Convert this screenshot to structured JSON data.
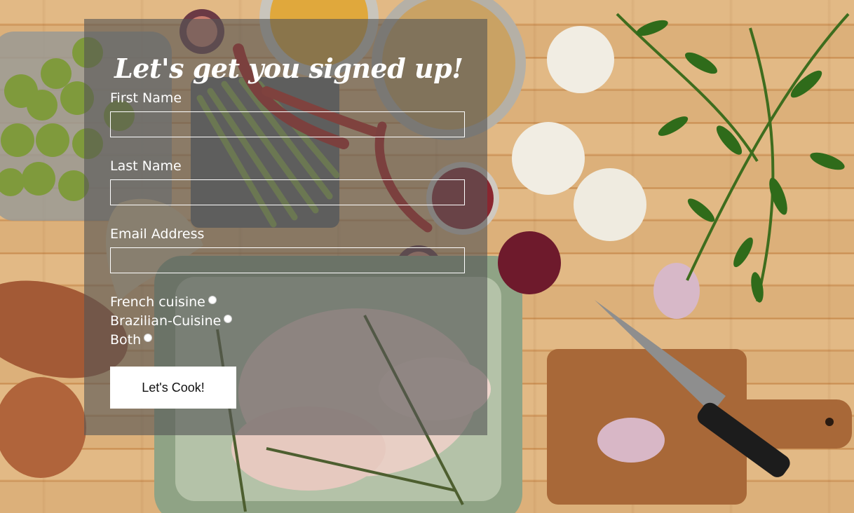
{
  "form": {
    "title": "Let's get you signed up!",
    "first_name_label": "First Name",
    "first_name_value": "",
    "last_name_label": "Last Name",
    "last_name_value": "",
    "email_label": "Email Address",
    "email_value": "",
    "cuisine_options": [
      "French cuisine",
      "Brazilian-Cuisine",
      "Both"
    ],
    "submit_label": "Let's Cook!"
  },
  "background": {
    "description_icon": "kitchen-table-photo"
  },
  "colors": {
    "panel_overlay": "#555555",
    "text": "#ffffff",
    "button_bg": "#ffffff"
  }
}
